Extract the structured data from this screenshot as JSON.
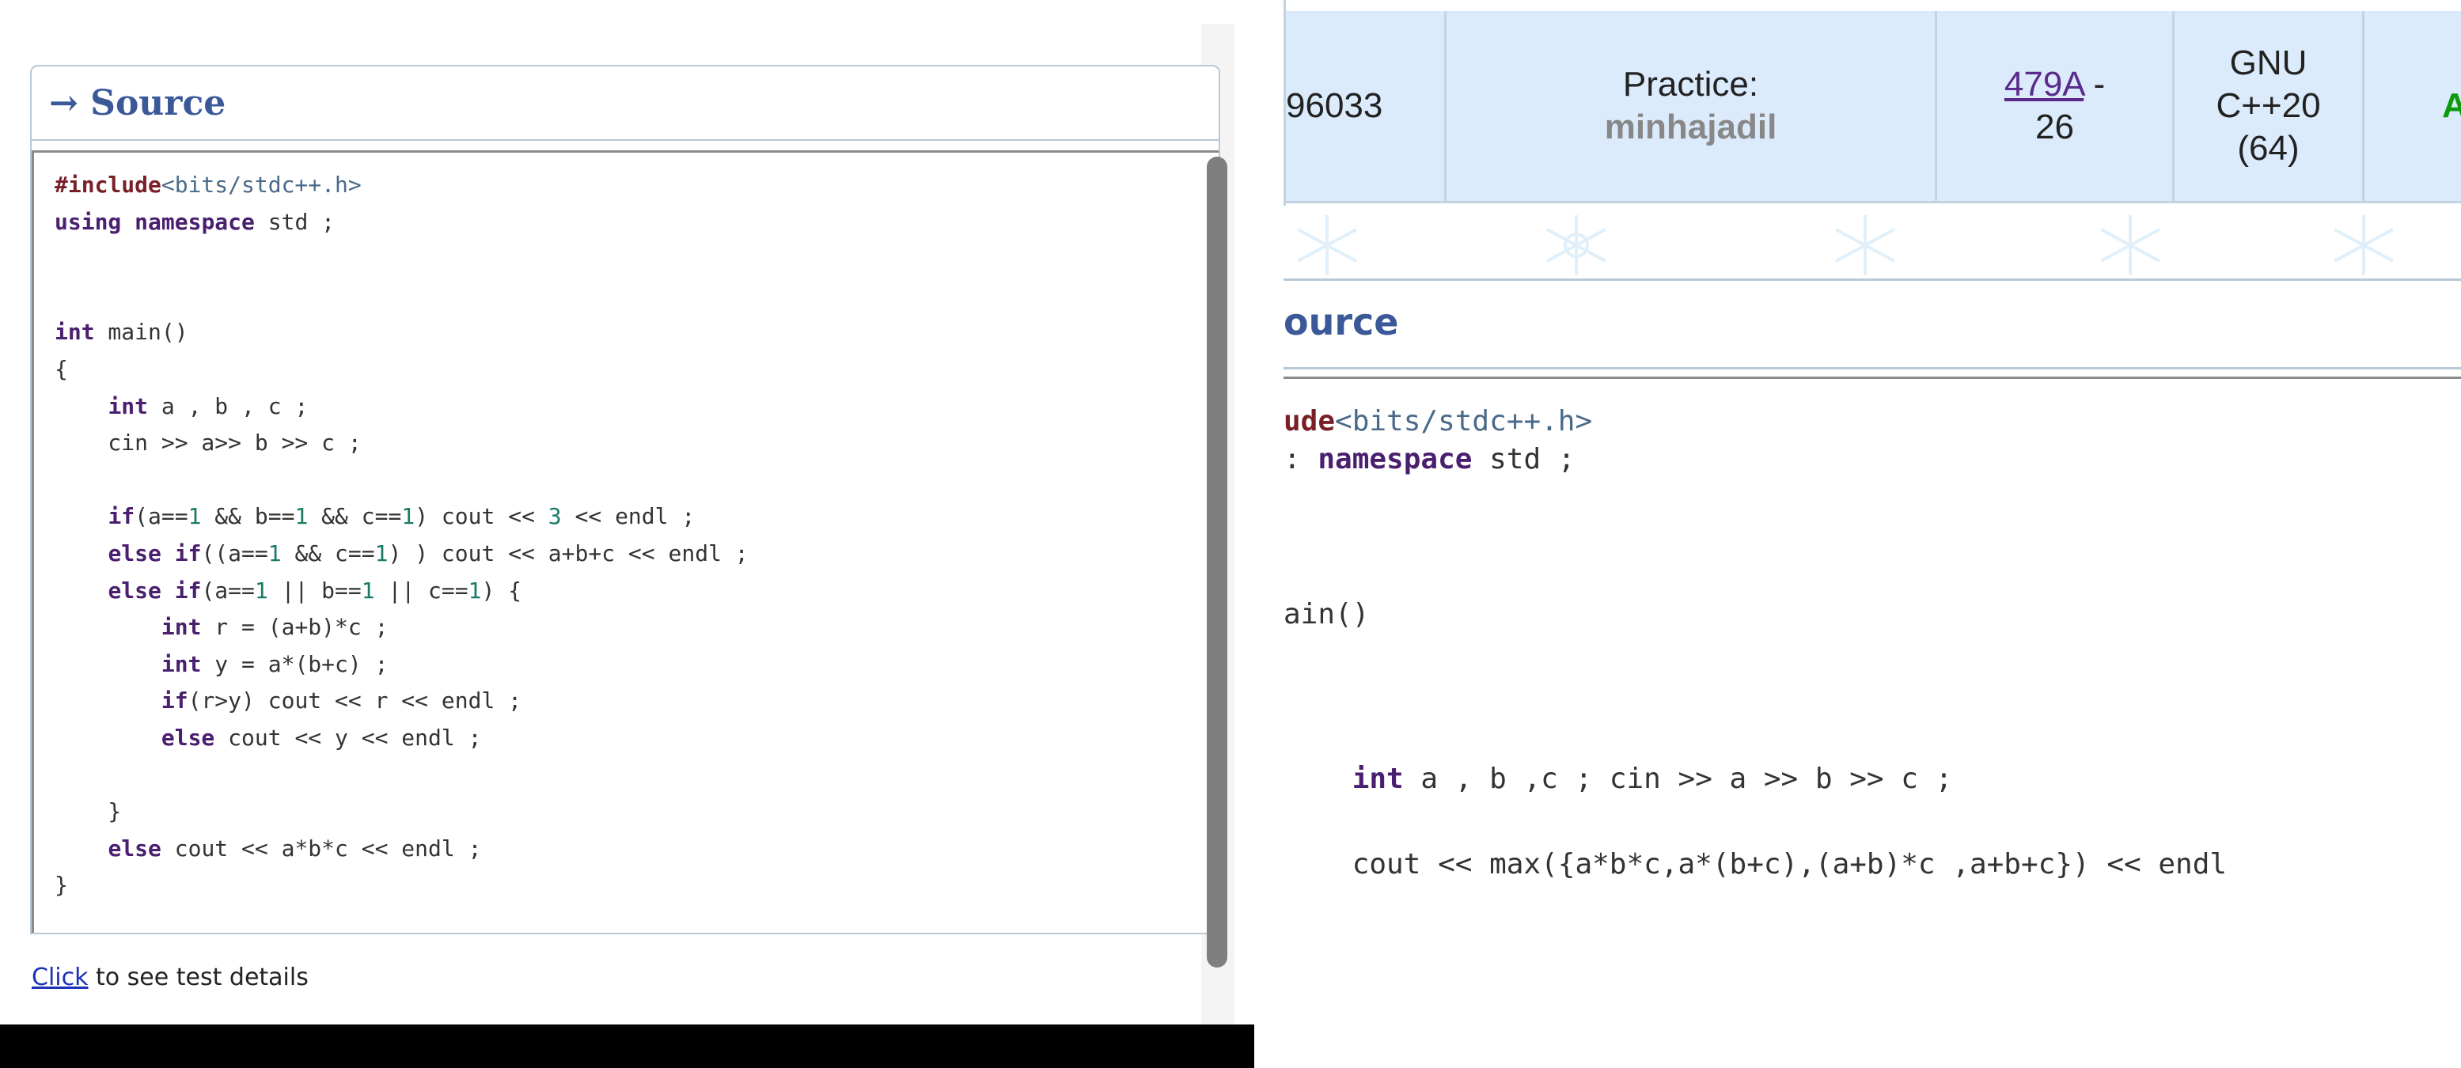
{
  "left_panel": {
    "source_header": "→ Source",
    "code_lines": [
      [
        {
          "t": "#include",
          "c": "pp"
        },
        {
          "t": "<bits/stdc++.h>",
          "c": "str"
        }
      ],
      [
        {
          "t": "using",
          "c": "kw"
        },
        {
          "t": " "
        },
        {
          "t": "namespace",
          "c": "kw"
        },
        {
          "t": " std ;"
        }
      ],
      [
        {
          "t": ""
        }
      ],
      [
        {
          "t": ""
        }
      ],
      [
        {
          "t": "int",
          "c": "kw"
        },
        {
          "t": " main()"
        }
      ],
      [
        {
          "t": "{"
        }
      ],
      [
        {
          "t": "    "
        },
        {
          "t": "int",
          "c": "kw"
        },
        {
          "t": " a , b , c ;"
        }
      ],
      [
        {
          "t": "    cin >> a>> b >> c ;"
        }
      ],
      [
        {
          "t": ""
        }
      ],
      [
        {
          "t": "    "
        },
        {
          "t": "if",
          "c": "kw"
        },
        {
          "t": "(a=="
        },
        {
          "t": "1",
          "c": "num"
        },
        {
          "t": " && b=="
        },
        {
          "t": "1",
          "c": "num"
        },
        {
          "t": " && c=="
        },
        {
          "t": "1",
          "c": "num"
        },
        {
          "t": ") cout << "
        },
        {
          "t": "3",
          "c": "num"
        },
        {
          "t": " << endl ;"
        }
      ],
      [
        {
          "t": "    "
        },
        {
          "t": "else if",
          "c": "kw"
        },
        {
          "t": "((a=="
        },
        {
          "t": "1",
          "c": "num"
        },
        {
          "t": " && c=="
        },
        {
          "t": "1",
          "c": "num"
        },
        {
          "t": ") ) cout << a+b+c << endl ;"
        }
      ],
      [
        {
          "t": "    "
        },
        {
          "t": "else if",
          "c": "kw"
        },
        {
          "t": "(a=="
        },
        {
          "t": "1",
          "c": "num"
        },
        {
          "t": " || b=="
        },
        {
          "t": "1",
          "c": "num"
        },
        {
          "t": " || c=="
        },
        {
          "t": "1",
          "c": "num"
        },
        {
          "t": ") {"
        }
      ],
      [
        {
          "t": "        "
        },
        {
          "t": "int",
          "c": "kw"
        },
        {
          "t": " r = (a+b)*c ;"
        }
      ],
      [
        {
          "t": "        "
        },
        {
          "t": "int",
          "c": "kw"
        },
        {
          "t": " y = a*(b+c) ;"
        }
      ],
      [
        {
          "t": "        "
        },
        {
          "t": "if",
          "c": "kw"
        },
        {
          "t": "(r>y) cout << r << endl ;"
        }
      ],
      [
        {
          "t": "        "
        },
        {
          "t": "else",
          "c": "kw"
        },
        {
          "t": " cout << y << endl ;"
        }
      ],
      [
        {
          "t": ""
        }
      ],
      [
        {
          "t": "    }"
        }
      ],
      [
        {
          "t": "    "
        },
        {
          "t": "else",
          "c": "kw"
        },
        {
          "t": " cout << a*b*c << endl ;"
        }
      ],
      [
        {
          "t": "}"
        }
      ]
    ],
    "click_link": "Click",
    "click_suffix": " to see test details"
  },
  "right_panel": {
    "submission_row": {
      "id": "96033",
      "party_label": "Practice:",
      "party_name": "minhajadil",
      "problem_link": "479A",
      "problem_suffix": " -",
      "problem_score": "26",
      "lang_line1": "GNU",
      "lang_line2": "C++20",
      "lang_line3": "(64)",
      "verdict": "A"
    },
    "source_header": "ource",
    "code_lines": [
      [
        {
          "t": "ude",
          "c": "pp"
        },
        {
          "t": "<bits/stdc++.h>",
          "c": "str"
        }
      ],
      [
        {
          "t": ": "
        },
        {
          "t": "namespace",
          "c": "kw"
        },
        {
          "t": " std ;"
        }
      ],
      [
        {
          "t": "ain()"
        }
      ],
      [
        {
          "t": "    "
        },
        {
          "t": "int",
          "c": "kw"
        },
        {
          "t": " a , b ,c ; cin >> a >> b >> c ;"
        }
      ],
      [
        {
          "t": "    cout << max({a*b*c,a*(b+c),(a+b)*c ,a+b+c}) << endl"
        }
      ]
    ]
  }
}
